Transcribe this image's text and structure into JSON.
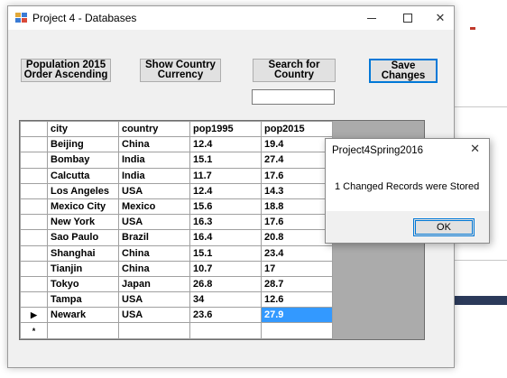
{
  "window": {
    "title": "Project 4 - Databases",
    "minimize_glyph": "",
    "close_glyph": "✕"
  },
  "toolbar": {
    "population_button": "Population 2015\nOrder Ascending",
    "currency_button": "Show Country\nCurrency",
    "search_button": "Search for\nCountry",
    "save_button": "Save\nChanges",
    "search_value": ""
  },
  "grid": {
    "columns": [
      "city",
      "country",
      "pop1995",
      "pop2015"
    ],
    "rows": [
      {
        "marker": "",
        "city": "Beijing",
        "country": "China",
        "pop1995": "12.4",
        "pop2015": "19.4"
      },
      {
        "marker": "",
        "city": "Bombay",
        "country": "India",
        "pop1995": "15.1",
        "pop2015": "27.4"
      },
      {
        "marker": "",
        "city": "Calcutta",
        "country": "India",
        "pop1995": "11.7",
        "pop2015": "17.6"
      },
      {
        "marker": "",
        "city": "Los Angeles",
        "country": "USA",
        "pop1995": "12.4",
        "pop2015": "14.3"
      },
      {
        "marker": "",
        "city": "Mexico City",
        "country": "Mexico",
        "pop1995": "15.6",
        "pop2015": "18.8"
      },
      {
        "marker": "",
        "city": "New York",
        "country": "USA",
        "pop1995": "16.3",
        "pop2015": "17.6"
      },
      {
        "marker": "",
        "city": "Sao Paulo",
        "country": "Brazil",
        "pop1995": "16.4",
        "pop2015": "20.8"
      },
      {
        "marker": "",
        "city": "Shanghai",
        "country": "China",
        "pop1995": "15.1",
        "pop2015": "23.4"
      },
      {
        "marker": "",
        "city": "Tianjin",
        "country": "China",
        "pop1995": "10.7",
        "pop2015": "17"
      },
      {
        "marker": "",
        "city": "Tokyo",
        "country": "Japan",
        "pop1995": "26.8",
        "pop2015": "28.7"
      },
      {
        "marker": "",
        "city": "Tampa",
        "country": "USA",
        "pop1995": "34",
        "pop2015": "12.6"
      },
      {
        "marker": "▶",
        "city": "Newark",
        "country": "USA",
        "pop1995": "23.6",
        "pop2015": "27.9"
      },
      {
        "marker": "*",
        "city": "",
        "country": "",
        "pop1995": "",
        "pop2015": ""
      }
    ],
    "selected_cell": {
      "row": 11,
      "column": "pop2015"
    },
    "selection_color": "#3399ff"
  },
  "dialog": {
    "title": "Project4Spring2016",
    "close_glyph": "✕",
    "message": "1 Changed Records were Stored",
    "ok_label": "OK"
  },
  "colors": {
    "accent": "#0078d7",
    "window_bg": "#f0f0f0",
    "grid_bg": "#ababab"
  },
  "icons": {
    "app": "app-window-icon",
    "row_pointer": "row-pointer-icon",
    "new_row": "new-row-icon"
  }
}
